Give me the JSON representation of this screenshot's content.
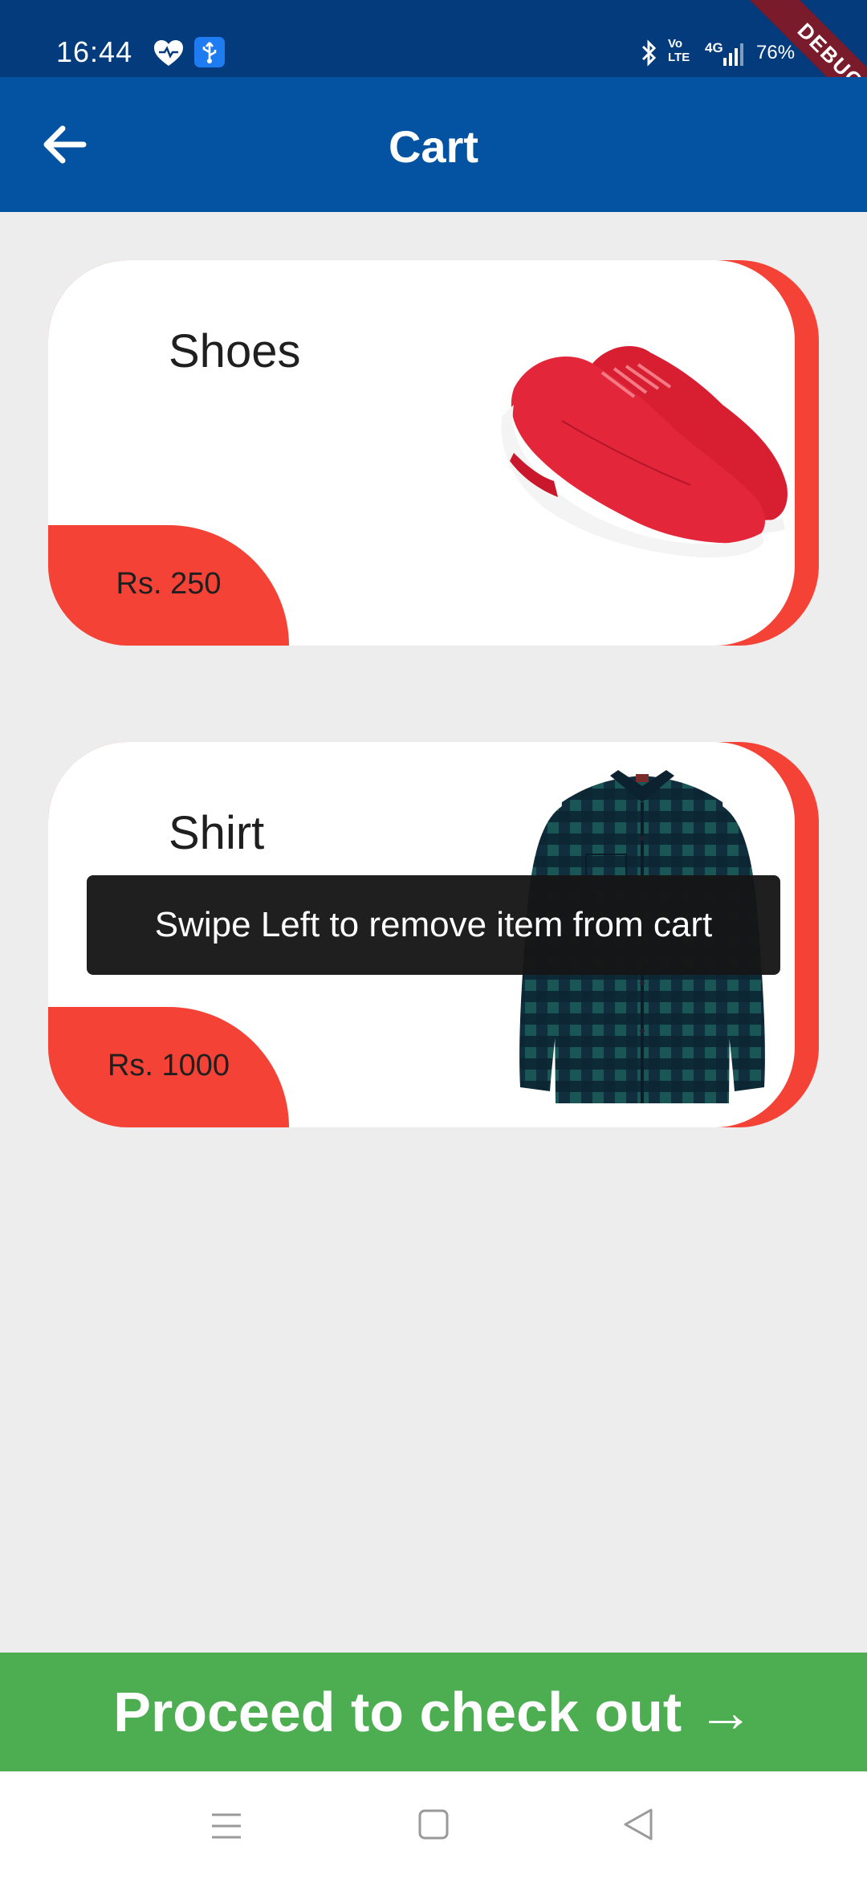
{
  "status_bar": {
    "time": "16:44",
    "volte": "Vo\nLTE",
    "network": "4G",
    "battery": "76%",
    "icons": [
      "heart-icon",
      "usb-icon",
      "bluetooth-icon",
      "volte-icon",
      "signal-icon",
      "battery-icon"
    ]
  },
  "debug_banner": "DEBUG",
  "app_bar": {
    "title": "Cart",
    "back_icon": "arrow-left-icon",
    "background": "#0452a2"
  },
  "cart": {
    "items": [
      {
        "name": "Shoes",
        "price": "Rs. 250",
        "image": "red-sneakers-image"
      },
      {
        "name": "Shirt",
        "price": "Rs. 1000",
        "image": "checked-shirt-image"
      }
    ],
    "accent": "#f44236"
  },
  "toast": "Swipe Left to remove item from cart",
  "checkout": {
    "label": "Proceed to check out →",
    "color": "#4cae50"
  },
  "nav_bar": {
    "icons": [
      "menu-icon",
      "home-icon",
      "back-icon"
    ]
  }
}
